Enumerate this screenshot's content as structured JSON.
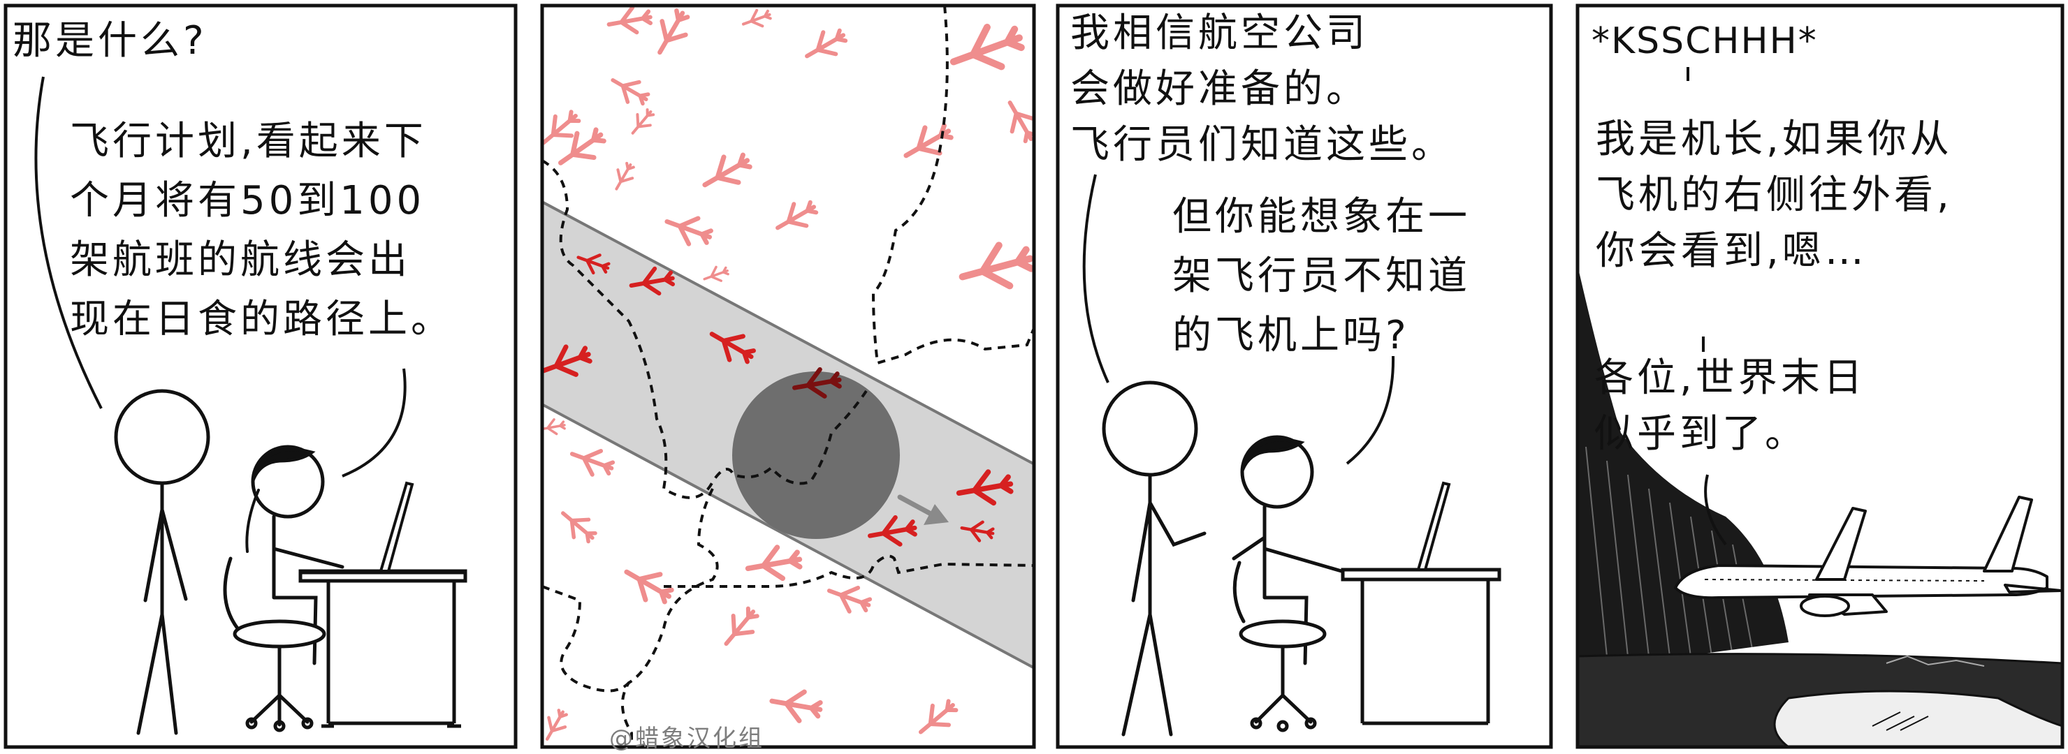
{
  "colors": {
    "ink": "#111111",
    "plane": "#d62020",
    "plane_faded": "#ef8d8d",
    "path_band": "#d4d4d4",
    "shadow": "#6e6e6e",
    "window": "#f5f5f5"
  },
  "panel1": {
    "question": "那是什么?",
    "answer": "飞行计划,看起来下\n个月将有50到100\n架航班的航线会出\n现在日食的路径上。"
  },
  "panel2": {
    "credit": "@蜡象汉化组"
  },
  "panel3": {
    "line": "我相信航空公司\n会做好准备的。\n飞行员们知道这些。",
    "reply": "但你能想象在一\n架飞行员不知道\n的飞机上吗?"
  },
  "panel4": {
    "sound": "*KSSCHHH*",
    "captain": "我是机长,如果你从\n飞机的右侧往外看,\n你会看到,嗯…",
    "ending": "各位,世界末日\n似乎到了。"
  }
}
